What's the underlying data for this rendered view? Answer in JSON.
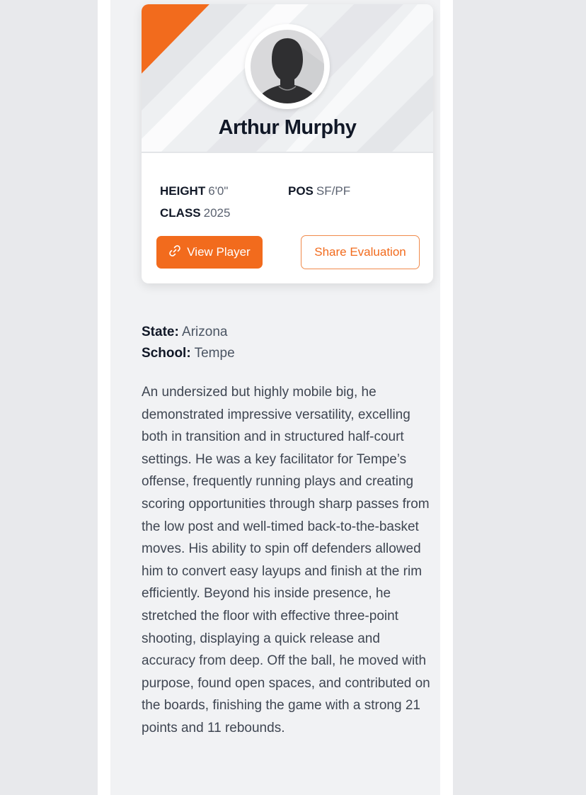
{
  "player": {
    "name": "Arthur Murphy",
    "avatar_icon": "person-silhouette-icon",
    "stats": {
      "height_label": "HEIGHT",
      "height_value": "6'0\"",
      "pos_label": "POS",
      "pos_value": "SF/PF",
      "class_label": "CLASS",
      "class_value": "2025"
    }
  },
  "actions": {
    "view_label": "View Player",
    "view_icon": "link-icon",
    "share_label": "Share Evaluation"
  },
  "details": {
    "state_label": "State:",
    "state_value": "Arizona",
    "school_label": "School:",
    "school_value": "Tempe"
  },
  "evaluation": "An undersized but highly mobile big, he demonstrated impressive versatility, excelling both in transition and in structured half-court settings. He was a key facilitator for Tempe’s offense, frequently running plays and creating scoring opportunities through sharp passes from the low post and well-timed back-to-the-basket moves. His ability to spin off defenders allowed him to convert easy layups and finish at the rim efficiently. Beyond his inside presence, he stretched the floor with effective three-point shooting, displaying a quick release and accuracy from deep. Off the ball, he moved with purpose, found open spaces, and contributed on the boards, finishing the game with a strong 21 points and 11 rebounds.",
  "colors": {
    "accent": "#f26b1d",
    "page_bg": "#e8e9ec",
    "panel_bg": "#f1f2f4",
    "heading": "#111827",
    "body_text": "#3f4652"
  }
}
